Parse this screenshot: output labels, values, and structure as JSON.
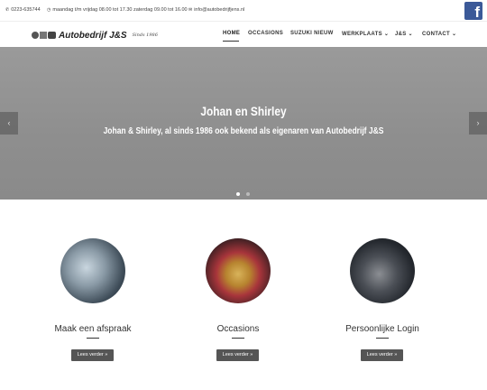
{
  "topbar": {
    "phone": "0223-635744",
    "hours": "maandag t/m vrijdag 08.00 tot 17.30 zaterdag 09.00 tot 16.00",
    "email": "info@autobedrijfjens.nl",
    "facebook_letter": "f"
  },
  "header": {
    "logo_text": "Autobedrijf J&S",
    "logo_since": "Sinds 1986",
    "nav": {
      "home": "HOME",
      "occasions": "OCCASIONS",
      "suzuki": "SUZUKI NIEUW",
      "werkplaats": "WERKPLAATS",
      "js": "J&S",
      "contact": "CONTACT"
    },
    "chevron": "⌄"
  },
  "slider": {
    "title": "Johan en Shirley",
    "subtitle": "Johan & Shirley, al sinds 1986 ook bekend als eigenaren van Autobedrijf J&S",
    "prev": "‹",
    "next": "›",
    "active_slide": 1,
    "slide_count": 2
  },
  "features": [
    {
      "title": "Maak een afspraak",
      "button": "Lees verder »"
    },
    {
      "title": "Occasions",
      "button": "Lees verder »"
    },
    {
      "title": "Persoonlijke Login",
      "button": "Lees verder »"
    }
  ],
  "colors": {
    "facebook": "#3b5998",
    "button_bg": "#555555",
    "slider_bg": "#8e8e8e"
  }
}
